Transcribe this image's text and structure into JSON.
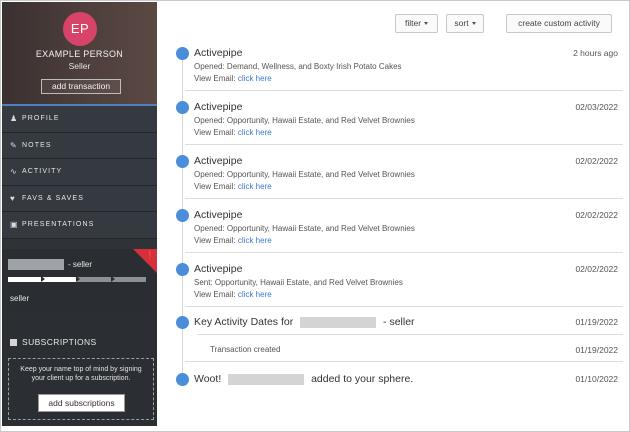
{
  "profile": {
    "initials": "EP",
    "name": "EXAMPLE PERSON",
    "role": "Seller",
    "add_transaction_label": "add transaction",
    "avatar_color": "#d8436a"
  },
  "nav": {
    "items": [
      {
        "icon": "person-icon",
        "label": "PROFILE"
      },
      {
        "icon": "notes-icon",
        "label": "NOTES"
      },
      {
        "icon": "activity-icon",
        "label": "ACTIVITY"
      },
      {
        "icon": "heart-icon",
        "label": "FAVS & SAVES"
      },
      {
        "icon": "presentation-icon",
        "label": "PRESENTATIONS"
      }
    ]
  },
  "seller": {
    "suffix": "- seller",
    "label": "seller",
    "progress": 0.5
  },
  "subscriptions": {
    "title": "SUBSCRIPTIONS",
    "text": "Keep your name top of mind by signing your client up for a subscription.",
    "button_label": "add subscriptions"
  },
  "toolbar": {
    "filter_label": "filter",
    "sort_label": "sort",
    "create_label": "create custom activity"
  },
  "accent": "#4a8dd9",
  "activities": [
    {
      "title": "Activepipe",
      "date": "2 hours ago",
      "detail": "Opened: Demand, Wellness, and Boxty Irish Potato Cakes",
      "view_prefix": "View Email:",
      "link": "click here"
    },
    {
      "title": "Activepipe",
      "date": "02/03/2022",
      "detail": "Opened: Opportunity, Hawaii Estate, and Red Velvet Brownies",
      "view_prefix": "View Email:",
      "link": "click here"
    },
    {
      "title": "Activepipe",
      "date": "02/02/2022",
      "detail": "Opened: Opportunity, Hawaii Estate, and Red Velvet Brownies",
      "view_prefix": "View Email:",
      "link": "click here"
    },
    {
      "title": "Activepipe",
      "date": "02/02/2022",
      "detail": "Opened: Opportunity, Hawaii Estate, and Red Velvet Brownies",
      "view_prefix": "View Email:",
      "link": "click here"
    },
    {
      "title": "Activepipe",
      "date": "02/02/2022",
      "detail": "Sent: Opportunity, Hawaii Estate, and Red Velvet Brownies",
      "view_prefix": "View Email:",
      "link": "click here"
    }
  ],
  "key_dates": {
    "title_prefix": "Key Activity Dates for",
    "title_suffix": "- seller",
    "date": "01/19/2022",
    "sub_text": "Transaction created",
    "sub_date": "01/19/2022"
  },
  "woot": {
    "prefix": "Woot!",
    "suffix": "added to your sphere.",
    "date": "01/10/2022"
  }
}
